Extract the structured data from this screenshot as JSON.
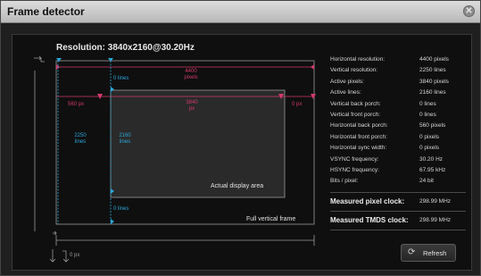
{
  "window": {
    "title": "Frame detector"
  },
  "resolution": {
    "label": "Resolution: 3840x2160@30.20Hz"
  },
  "diagram": {
    "h_total": {
      "value": "4400",
      "unit": "pixels"
    },
    "h_active": {
      "value": "3840",
      "unit": "px"
    },
    "v_back_porch": "0 lines",
    "v_front_porch": "0 lines",
    "h_back_porch": "560 px",
    "h_front_porch": "0 px",
    "h_sync": "0 px",
    "v_total": {
      "value": "2250",
      "unit": "lines"
    },
    "v_active": {
      "value": "2160",
      "unit": "lines"
    },
    "active_area_label": "Actual display area",
    "full_frame_label": "Full vertical frame"
  },
  "stats": [
    {
      "label": "Horizontal resolution:",
      "value": "4400 pixels"
    },
    {
      "label": "Vertical resolution:",
      "value": "2250 lines"
    },
    {
      "label": "Active pixels:",
      "value": "3840 pixels"
    },
    {
      "label": "Active lines:",
      "value": "2160 lines"
    },
    {
      "label": "Vertical back porch:",
      "value": "0 lines"
    },
    {
      "label": "Vertical front porch:",
      "value": "0 lines"
    },
    {
      "label": "Horizontal back porch:",
      "value": "560 pixels"
    },
    {
      "label": "Horizontal front porch:",
      "value": "0 pixels"
    },
    {
      "label": "Horizontal sync width:",
      "value": "0 pixels"
    },
    {
      "label": "VSYNC frequency:",
      "value": "30.20 Hz"
    },
    {
      "label": "HSYNC frequency:",
      "value": "67.95 kHz"
    },
    {
      "label": "Bits / pixel:",
      "value": "24 bit"
    }
  ],
  "clocks": {
    "pixel": {
      "label": "Measured pixel clock:",
      "value": "298.99 MHz"
    },
    "tmds": {
      "label": "Measured TMDS clock:",
      "value": "298.99 MHz"
    }
  },
  "refresh_button": {
    "label": "Refresh",
    "icon": "refresh-icon"
  },
  "colors": {
    "accent_cyan": "#2aa7d8",
    "accent_pink": "#d03a6a"
  }
}
